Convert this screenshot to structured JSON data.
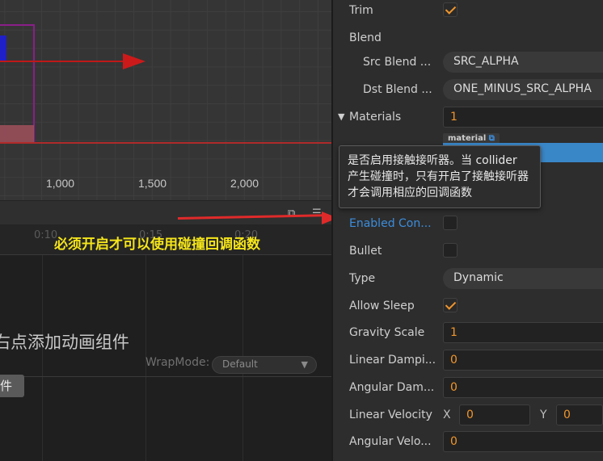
{
  "scene": {
    "ticks": [
      "1,000",
      "1,500",
      "2,000"
    ]
  },
  "timeline": {
    "ruler": [
      "0:10",
      "0:15",
      "0:20"
    ],
    "hint": "右点添加动画组件",
    "wrap_mode_label": "WrapMode:",
    "wrap_mode_value": "Default",
    "add_button": "件"
  },
  "annotation": "必须开启才可以使用碰撞回调函数",
  "tooltip": "是否启用接触接听器。当 collider 产生碰撞时，只有开启了接触接听器才会调用相应的回调函数",
  "inspector": {
    "trim": {
      "label": "Trim",
      "checked": true
    },
    "blend": {
      "label": "Blend"
    },
    "src_blend": {
      "label": "Src Blend ...",
      "value": "SRC_ALPHA"
    },
    "dst_blend": {
      "label": "Dst Blend ...",
      "value": "ONE_MINUS_SRC_ALPHA"
    },
    "materials": {
      "label": "Materials",
      "value": "1",
      "tag": "material"
    },
    "enabled_contact": {
      "label": "Enabled Con...",
      "checked": false
    },
    "bullet": {
      "label": "Bullet",
      "checked": false
    },
    "type": {
      "label": "Type",
      "value": "Dynamic"
    },
    "allow_sleep": {
      "label": "Allow Sleep",
      "checked": true
    },
    "gravity_scale": {
      "label": "Gravity Scale",
      "value": "1"
    },
    "linear_damping": {
      "label": "Linear Dampi...",
      "value": "0"
    },
    "angular_damping": {
      "label": "Angular Dam...",
      "value": "0"
    },
    "linear_velocity": {
      "label": "Linear Velocity",
      "x_label": "X",
      "x": "0",
      "y_label": "Y",
      "y": "0"
    },
    "angular_velocity": {
      "label": "Angular Velo...",
      "value": "0"
    }
  },
  "colors": {
    "accent_orange": "#f0962c",
    "accent_blue": "#3c8ddc",
    "annotation_yellow": "#f5e51a",
    "arrow_red": "#e02a2a"
  }
}
